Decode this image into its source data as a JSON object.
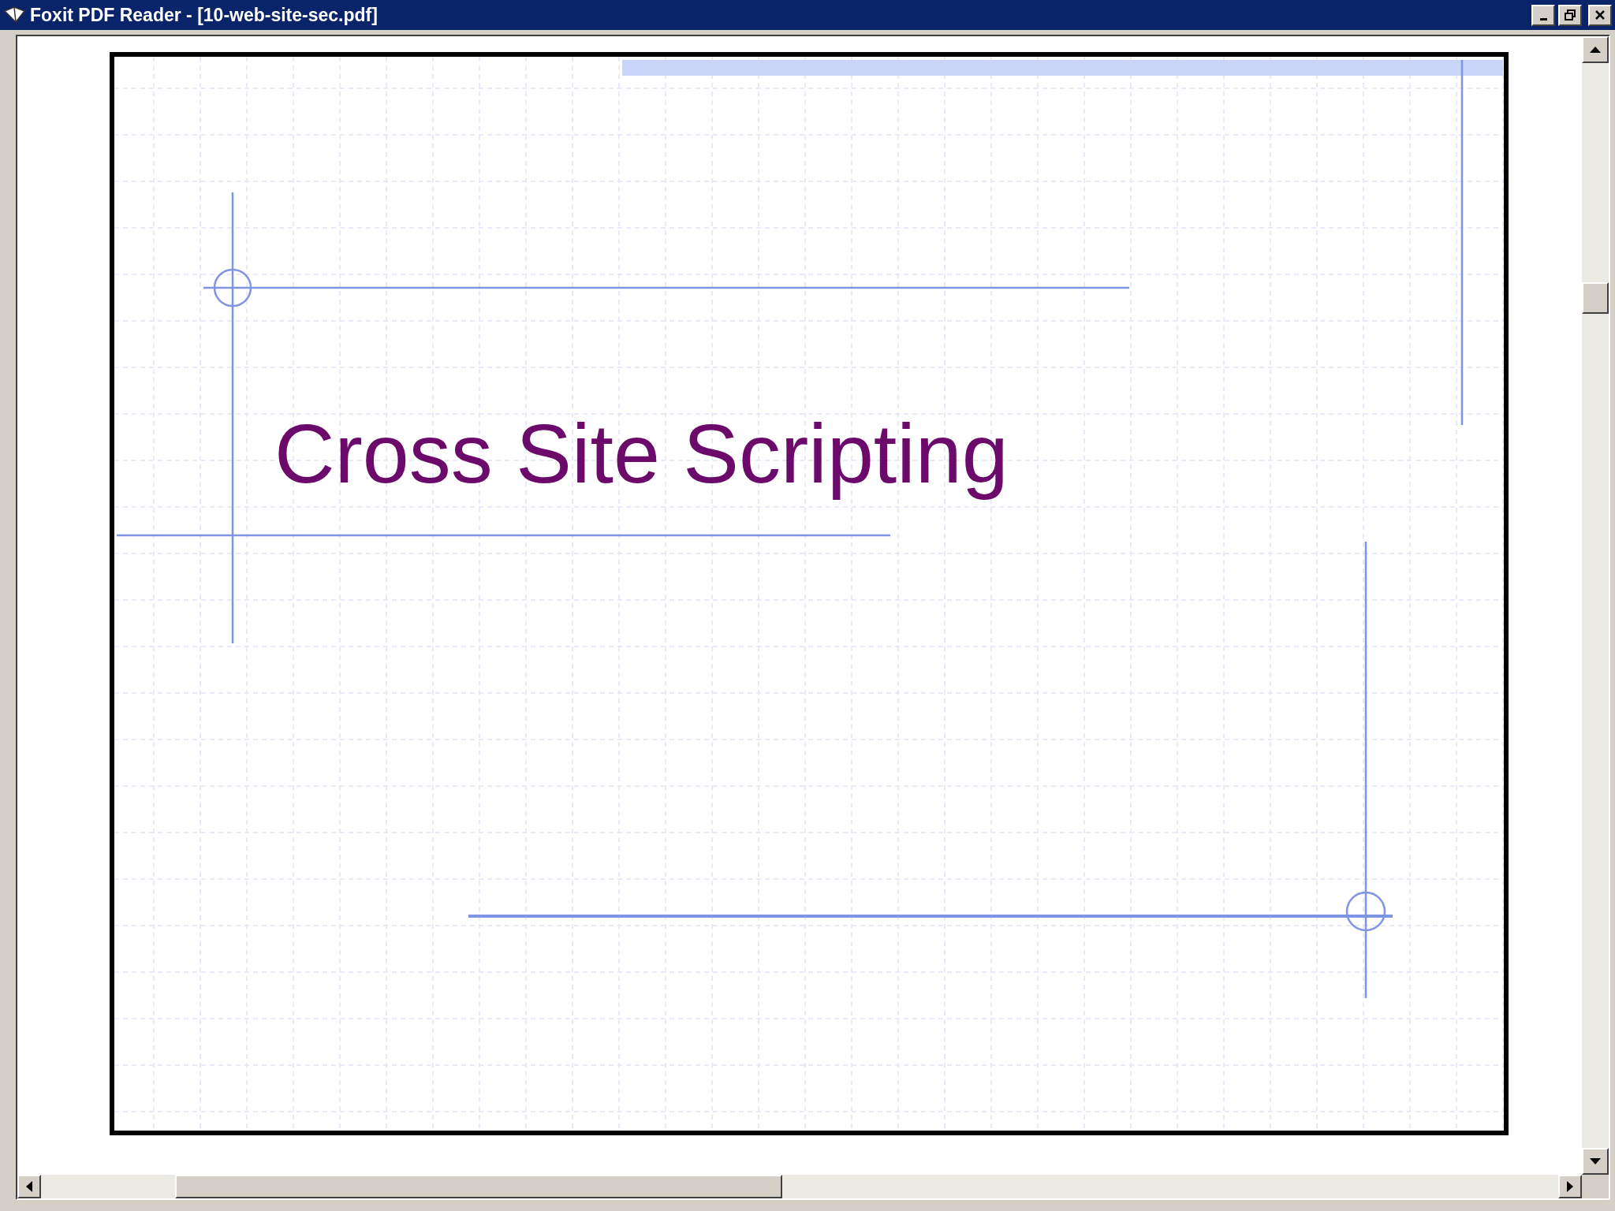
{
  "window": {
    "title": "Foxit PDF Reader - [10-web-site-sec.pdf]"
  },
  "slide": {
    "title": "Cross Site Scripting"
  }
}
